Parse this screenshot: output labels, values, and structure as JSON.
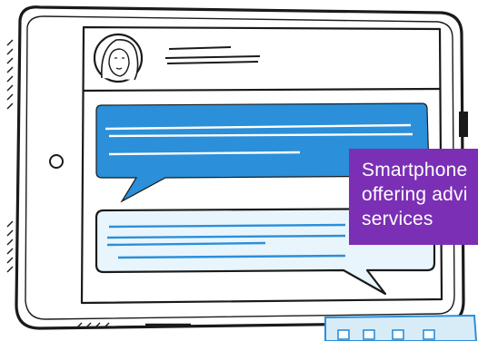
{
  "illustration": {
    "subject": "tablet showing a chat conversation with a profile avatar",
    "colors": {
      "outline": "#1a1a1a",
      "bubble_filled": "#2b8fd9",
      "bubble_outline_fill": "#e9f5fc",
      "screen": "#ffffff",
      "caption_bg": "#7b2fb5",
      "caption_text": "#ffffff"
    }
  },
  "caption": {
    "text": "Smartphone\noffering advi\nservices"
  }
}
